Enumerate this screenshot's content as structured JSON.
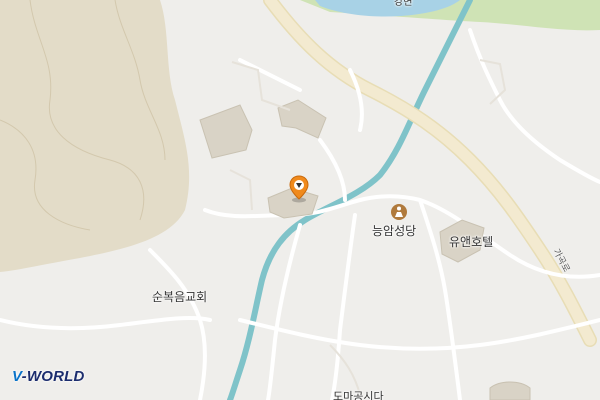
{
  "map": {
    "logo_text": "-WORLD",
    "logo_prefix": "V",
    "labels": {
      "church_neungam": "능암성당",
      "church_sunbokeum": "순복음교회",
      "hotel": "유앤호텔",
      "road": "가곡로",
      "bottom_partial": "도마공시다",
      "top_partial": "강변"
    },
    "colors": {
      "background": "#efeeeb",
      "water": "#a8d2e6",
      "stream": "#7fc3c9",
      "green": "#cfe3b5",
      "mountain": "#e3dcc8",
      "road_main": "#f1e7c4",
      "road_minor": "#ffffff",
      "building": "#d9d3c6",
      "marker": "#f08a1c"
    },
    "icons": {
      "marker": "location-pin-icon",
      "church": "person-icon"
    }
  }
}
